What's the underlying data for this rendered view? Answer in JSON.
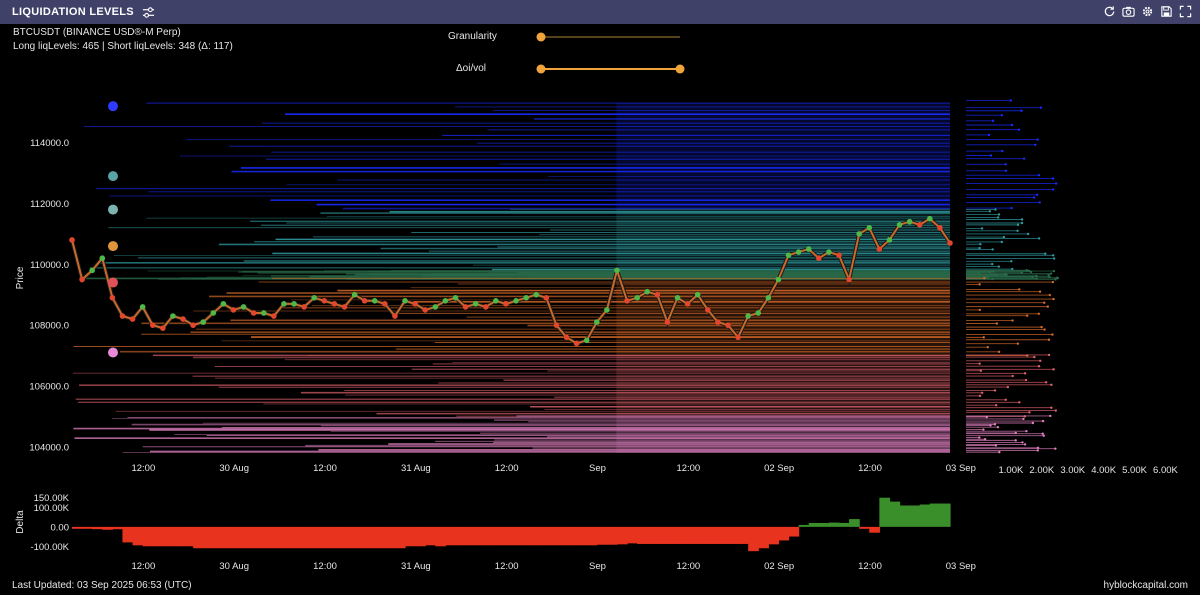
{
  "header": {
    "title": "LIQUIDATION LEVELS",
    "tool_icons": [
      "refresh-icon",
      "camera-icon",
      "gear-icon",
      "save-icon",
      "fullscreen-icon"
    ]
  },
  "info": {
    "symbol": "BTCUSDT (BINANCE USD®-M Perp)",
    "liq_summary": "Long liqLevels: 465 | Short liqLevels: 348 (Δ: 117)"
  },
  "controls": {
    "granularity": {
      "label": "Granularity",
      "value": 0.0
    },
    "oi_vol": {
      "label": "Δoi/vol",
      "range": [
        0.0,
        1.0
      ]
    }
  },
  "chart_data": [
    {
      "type": "line",
      "panel": "price",
      "ylabel": "Price",
      "ylim": [
        103500,
        115600
      ],
      "yticks": [
        104000,
        106000,
        108000,
        110000,
        112000,
        114000
      ],
      "ytick_labels": [
        "104000.0",
        "106000.0",
        "108000.0",
        "110000.0",
        "112000.0",
        "114000.0"
      ],
      "xlim": [
        0,
        87
      ],
      "xticks": [
        4,
        13,
        22,
        31,
        40,
        49,
        58,
        67,
        76,
        85
      ],
      "xtick_labels": [
        "12:00",
        "30 Aug",
        "12:00",
        "31 Aug",
        "12:00",
        "Sep",
        "12:00",
        "02 Sep",
        "12:00",
        "03 Sep"
      ],
      "x_hours_since_start": [
        0,
        1,
        2,
        3,
        4,
        5,
        6,
        7,
        8,
        9,
        10,
        11,
        12,
        13,
        14,
        15,
        16,
        17,
        18,
        19,
        20,
        21,
        22,
        23,
        24,
        25,
        26,
        27,
        28,
        29,
        30,
        31,
        32,
        33,
        34,
        35,
        36,
        37,
        38,
        39,
        40,
        41,
        42,
        43,
        44,
        45,
        46,
        47,
        48,
        49,
        50,
        51,
        52,
        53,
        54,
        55,
        56,
        57,
        58,
        59,
        60,
        61,
        62,
        63,
        64,
        65,
        66,
        67,
        68,
        69,
        70,
        71,
        72,
        73,
        74,
        75,
        76,
        77,
        78,
        79,
        80,
        81,
        82,
        83,
        84,
        85,
        86,
        87
      ],
      "series": [
        {
          "values": [
            110800,
            109500,
            109800,
            110200,
            108900,
            108300,
            108200,
            108600,
            108000,
            107900,
            108300,
            108200,
            108000,
            108100,
            108400,
            108700,
            108500,
            108600,
            108400,
            108400,
            108300,
            108700,
            108700,
            108600,
            108900,
            108800,
            108700,
            108600,
            109000,
            108800,
            108800,
            108700,
            108300,
            108800,
            108700,
            108500,
            108600,
            108800,
            108900,
            108600,
            108700,
            108600,
            108800,
            108700,
            108800,
            108900,
            109000,
            108900,
            108000,
            107600,
            107400,
            107500,
            108100,
            108500,
            109800,
            108800,
            108900,
            109100,
            109000,
            108100,
            108900,
            108700,
            109000,
            108500,
            108100,
            108000,
            107600,
            108300,
            108400,
            108900,
            109500,
            110300,
            110400,
            110500,
            110200,
            110400,
            110300,
            109500,
            111000,
            111200,
            110500,
            110800,
            111300,
            111400,
            111300,
            111500,
            111200,
            110700
          ]
        }
      ],
      "liquidation_bands": [
        {
          "from": 111800,
          "to": 115300,
          "color": "#1a2bff"
        },
        {
          "from": 109800,
          "to": 111800,
          "color": "#2f9aa0"
        },
        {
          "from": 109500,
          "to": 109800,
          "color": "#2a6b4a"
        },
        {
          "from": 107000,
          "to": 109500,
          "color": "#d86a2a"
        },
        {
          "from": 105000,
          "to": 107000,
          "color": "#e0626d"
        },
        {
          "from": 103800,
          "to": 105000,
          "color": "#e080c0"
        }
      ],
      "markers": [
        {
          "price": 115200,
          "color": "#2e3bff"
        },
        {
          "price": 112900,
          "color": "#5aa3a6"
        },
        {
          "price": 111800,
          "color": "#7bb3b0"
        },
        {
          "price": 110600,
          "color": "#e0953c"
        },
        {
          "price": 109400,
          "color": "#e0505a"
        },
        {
          "price": 107100,
          "color": "#e98ad8"
        }
      ],
      "right_panel": {
        "xticks": [
          1000,
          2000,
          3000,
          4000,
          5000,
          6000
        ],
        "xtick_labels": [
          "1.00K",
          "2.00K",
          "3.00K",
          "4.00K",
          "5.00K",
          "6.00K"
        ]
      }
    },
    {
      "type": "area",
      "panel": "delta",
      "ylabel": "Delta",
      "ylim": [
        -150000,
        200000
      ],
      "yticks": [
        -100000,
        0,
        100000,
        150000
      ],
      "ytick_labels": [
        "-100.00K",
        "0.00",
        "100.00K",
        "150.00K"
      ],
      "xtick_labels": [
        "12:00",
        "30 Aug",
        "12:00",
        "31 Aug",
        "12:00",
        "Sep",
        "12:00",
        "02 Sep",
        "12:00",
        "03 Sep"
      ],
      "positive_color": "#3a8f2b",
      "negative_color": "#e8331f",
      "series": [
        {
          "values": [
            -10000,
            -10000,
            -12000,
            -15000,
            -12000,
            -80000,
            -95000,
            -100000,
            -100000,
            -100000,
            -100000,
            -100000,
            -110000,
            -110000,
            -110000,
            -110000,
            -110000,
            -110000,
            -110000,
            -110000,
            -110000,
            -110000,
            -110000,
            -110000,
            -110000,
            -110000,
            -110000,
            -110000,
            -110000,
            -110000,
            -110000,
            -110000,
            -110000,
            -100000,
            -100000,
            -95000,
            -100000,
            -95000,
            -95000,
            -95000,
            -95000,
            -95000,
            -95000,
            -95000,
            -95000,
            -95000,
            -95000,
            -95000,
            -95000,
            -95000,
            -95000,
            -95000,
            -92000,
            -92000,
            -90000,
            -85000,
            -88000,
            -88000,
            -88000,
            -88000,
            -88000,
            -88000,
            -88000,
            -88000,
            -88000,
            -88000,
            -88000,
            -125000,
            -110000,
            -90000,
            -70000,
            -50000,
            10000,
            20000,
            20000,
            22000,
            20000,
            40000,
            -10000,
            -30000,
            150000,
            130000,
            110000,
            110000,
            115000,
            120000,
            120000,
            120000
          ]
        }
      ]
    }
  ],
  "footer": {
    "last_updated": "Last Updated: 03 Sep 2025 06:53 (UTC)",
    "brand": "hyblockcapital.com"
  }
}
